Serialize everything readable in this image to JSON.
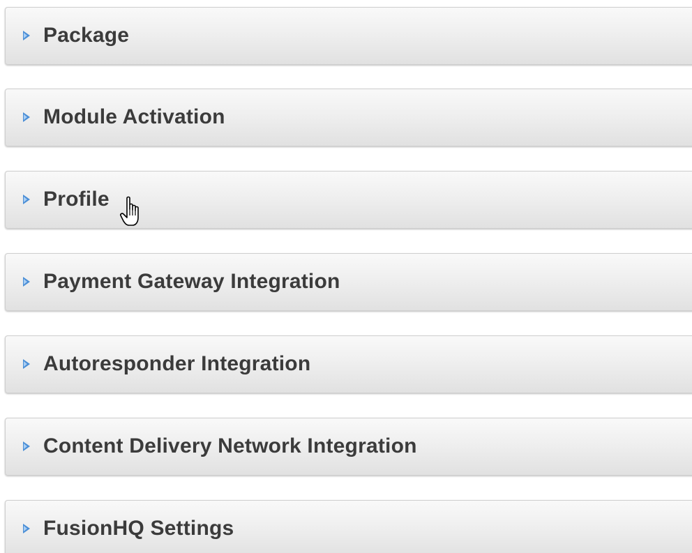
{
  "accordion": {
    "sections": [
      {
        "label": "Package",
        "expanded": false
      },
      {
        "label": "Module Activation",
        "expanded": false
      },
      {
        "label": "Profile",
        "expanded": false
      },
      {
        "label": "Payment Gateway Integration",
        "expanded": false
      },
      {
        "label": "Autoresponder Integration",
        "expanded": false
      },
      {
        "label": "Content Delivery Network Integration",
        "expanded": false
      },
      {
        "label": "FusionHQ Settings",
        "expanded": false
      }
    ]
  },
  "icons": {
    "section_arrow": "triangle-right-icon",
    "cursor": "hand-pointer-cursor-icon"
  },
  "colors": {
    "arrow": "#4a8ed6",
    "label_text": "#3b3b3b",
    "panel_border": "#cfcfcf"
  }
}
